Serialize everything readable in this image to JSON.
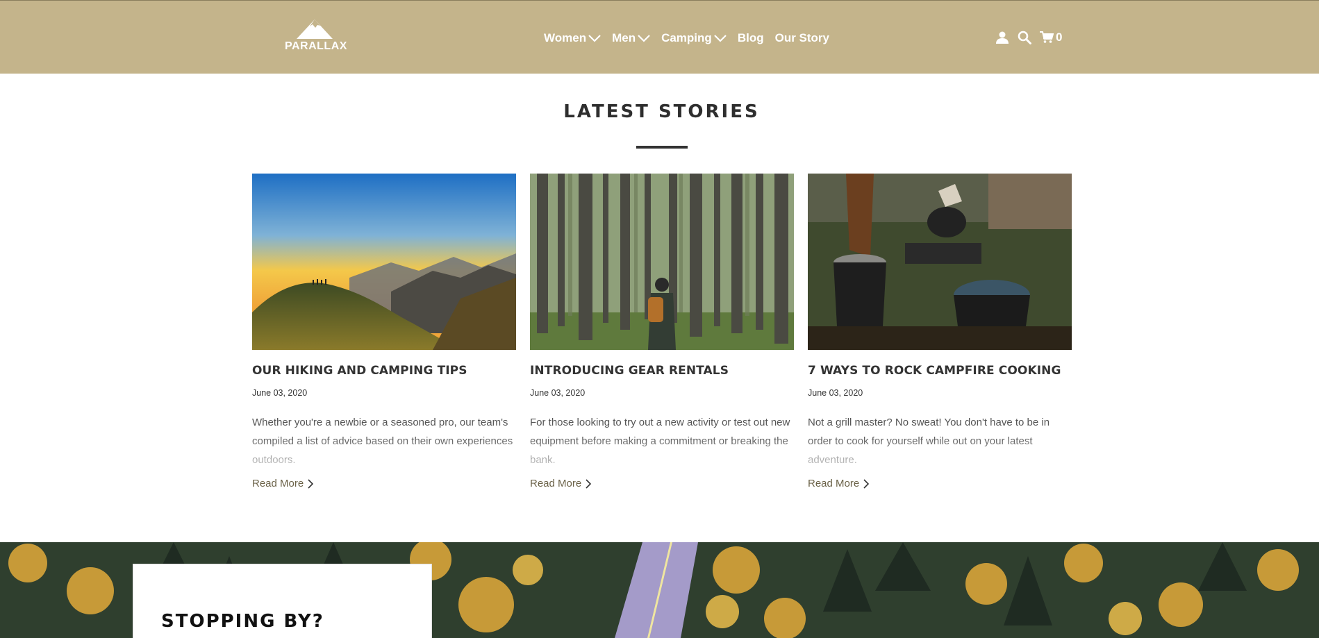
{
  "header": {
    "logo_text": "PARALLAX",
    "nav": [
      {
        "label": "Women",
        "has_dropdown": true
      },
      {
        "label": "Men",
        "has_dropdown": true
      },
      {
        "label": "Camping",
        "has_dropdown": true
      },
      {
        "label": "Blog",
        "has_dropdown": false
      },
      {
        "label": "Our Story",
        "has_dropdown": false
      }
    ],
    "icons": [
      "user-icon",
      "search-icon",
      "cart-icon"
    ],
    "cart_count": "0",
    "background_color": "#c4b48b"
  },
  "latest_stories": {
    "title": "LATEST STORIES",
    "posts": [
      {
        "title": "OUR HIKING AND CAMPING TIPS",
        "date": "June 03, 2020",
        "excerpt": "Whether you're a newbie or a seasoned pro, our team's compiled a list of advice based on their own experiences outdoors.",
        "read_more": "Read More",
        "image": "mountain-sunset-hikers"
      },
      {
        "title": "INTRODUCING GEAR RENTALS",
        "date": "June 03, 2020",
        "excerpt": "For those looking to try out a new activity or test out new equipment before making a commitment or breaking the bank.",
        "read_more": "Read More",
        "image": "hiker-in-forest"
      },
      {
        "title": "7 WAYS TO ROCK CAMPFIRE COOKING",
        "date": "June 03, 2020",
        "excerpt": "Not a grill master? No sweat! You don't have to be in order to cook for yourself while out on your latest adventure.",
        "read_more": "Read More",
        "image": "campfire-kettles"
      }
    ]
  },
  "banner": {
    "title": "STOPPING BY?",
    "image": "forest-road-aerial"
  }
}
